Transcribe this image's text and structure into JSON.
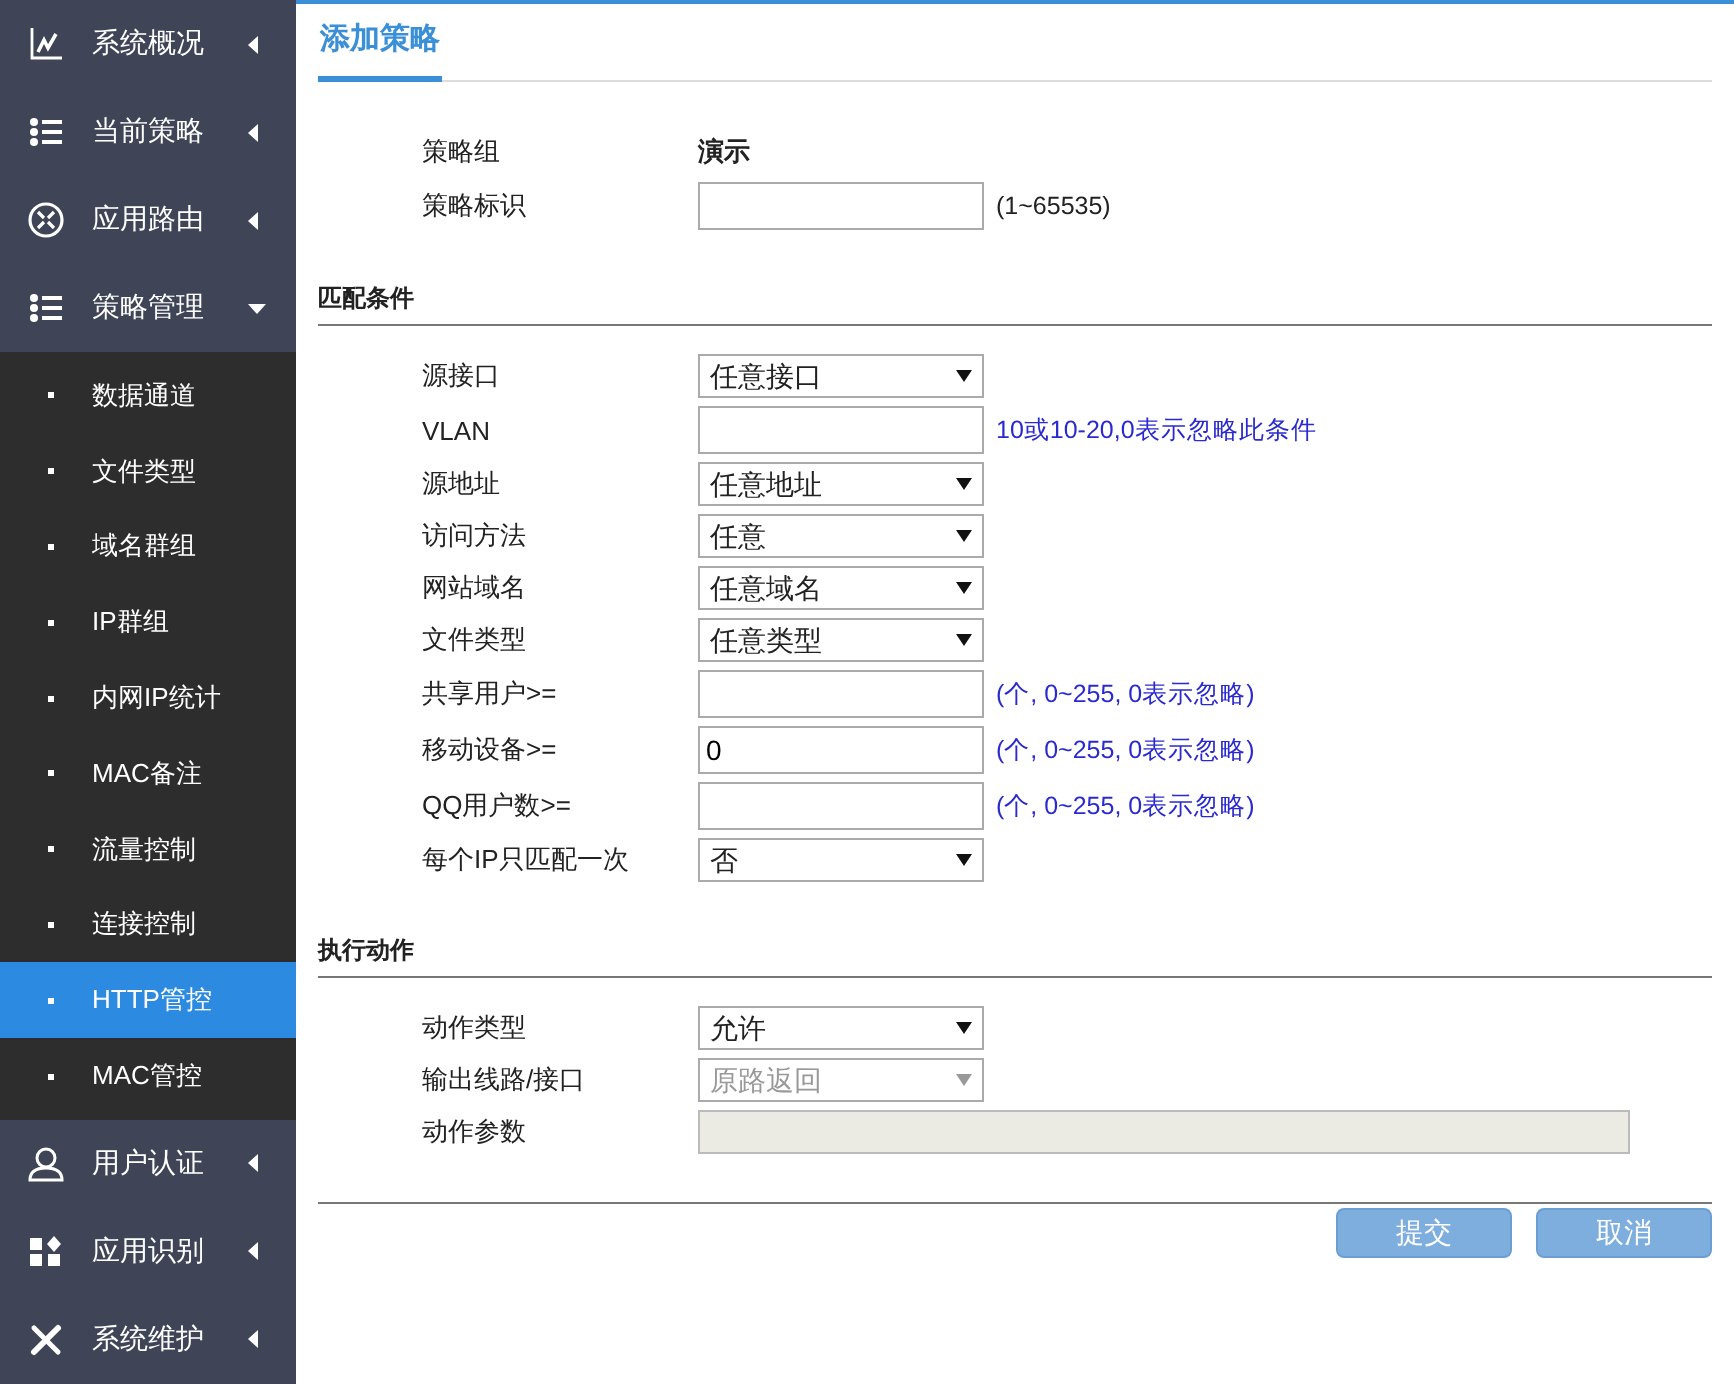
{
  "sidebar": {
    "items": [
      {
        "label": "系统概况",
        "expanded": false
      },
      {
        "label": "当前策略",
        "expanded": false
      },
      {
        "label": "应用路由",
        "expanded": false
      },
      {
        "label": "策略管理",
        "expanded": true,
        "children": [
          {
            "label": "数据通道",
            "selected": false
          },
          {
            "label": "文件类型",
            "selected": false
          },
          {
            "label": "域名群组",
            "selected": false
          },
          {
            "label": "IP群组",
            "selected": false
          },
          {
            "label": "内网IP统计",
            "selected": false
          },
          {
            "label": "MAC备注",
            "selected": false
          },
          {
            "label": "流量控制",
            "selected": false
          },
          {
            "label": "连接控制",
            "selected": false
          },
          {
            "label": "HTTP管控",
            "selected": true
          },
          {
            "label": "MAC管控",
            "selected": false
          }
        ]
      },
      {
        "label": "用户认证",
        "expanded": false
      },
      {
        "label": "应用识别",
        "expanded": false
      },
      {
        "label": "系统维护",
        "expanded": false
      }
    ]
  },
  "tab": {
    "label": "添加策略",
    "selected": true
  },
  "sections": [
    {
      "rows": [
        {
          "kind": "static",
          "label": "策略组",
          "value": "演示"
        },
        {
          "kind": "input",
          "label": "策略标识",
          "disabled": false,
          "note": {
            "text": "(1~65535)",
            "color": "#222222"
          }
        }
      ]
    },
    {
      "title": "匹配条件",
      "rows": [
        {
          "kind": "select",
          "label": "源接口",
          "value": "任意接口",
          "disabled": false
        },
        {
          "kind": "input",
          "label": "VLAN",
          "disabled": false,
          "note": {
            "text": "10或10-20,0表示忽略此条件",
            "color": "#2a2ad0"
          }
        },
        {
          "kind": "select",
          "label": "源地址",
          "value": "任意地址",
          "disabled": false
        },
        {
          "kind": "select",
          "label": "访问方法",
          "value": "任意",
          "disabled": false
        },
        {
          "kind": "select",
          "label": "网站域名",
          "value": "任意域名",
          "disabled": false
        },
        {
          "kind": "select",
          "label": "文件类型",
          "value": "任意类型",
          "disabled": false
        },
        {
          "kind": "input",
          "label": "共享用户>=",
          "disabled": false,
          "note": {
            "text": "(个, 0~255, 0表示忽略)",
            "color": "#2a2ad0"
          }
        },
        {
          "kind": "input",
          "label": "移动设备>=",
          "value": "0",
          "disabled": false,
          "note": {
            "text": "(个, 0~255, 0表示忽略)",
            "color": "#2a2ad0"
          }
        },
        {
          "kind": "input",
          "label": "QQ用户数>=",
          "disabled": false,
          "note": {
            "text": "(个, 0~255, 0表示忽略)",
            "color": "#2a2ad0"
          }
        },
        {
          "kind": "select",
          "label": "每个IP只匹配一次",
          "value": "否",
          "disabled": false
        }
      ]
    },
    {
      "title": "执行动作",
      "rows": [
        {
          "kind": "select",
          "label": "动作类型",
          "value": "允许",
          "disabled": false
        },
        {
          "kind": "select",
          "label": "输出线路/接口",
          "value": "原路返回",
          "disabled": true
        },
        {
          "kind": "wide",
          "label": "动作参数",
          "disabled": true
        }
      ]
    }
  ],
  "buttons": [
    "提交",
    "取消"
  ]
}
